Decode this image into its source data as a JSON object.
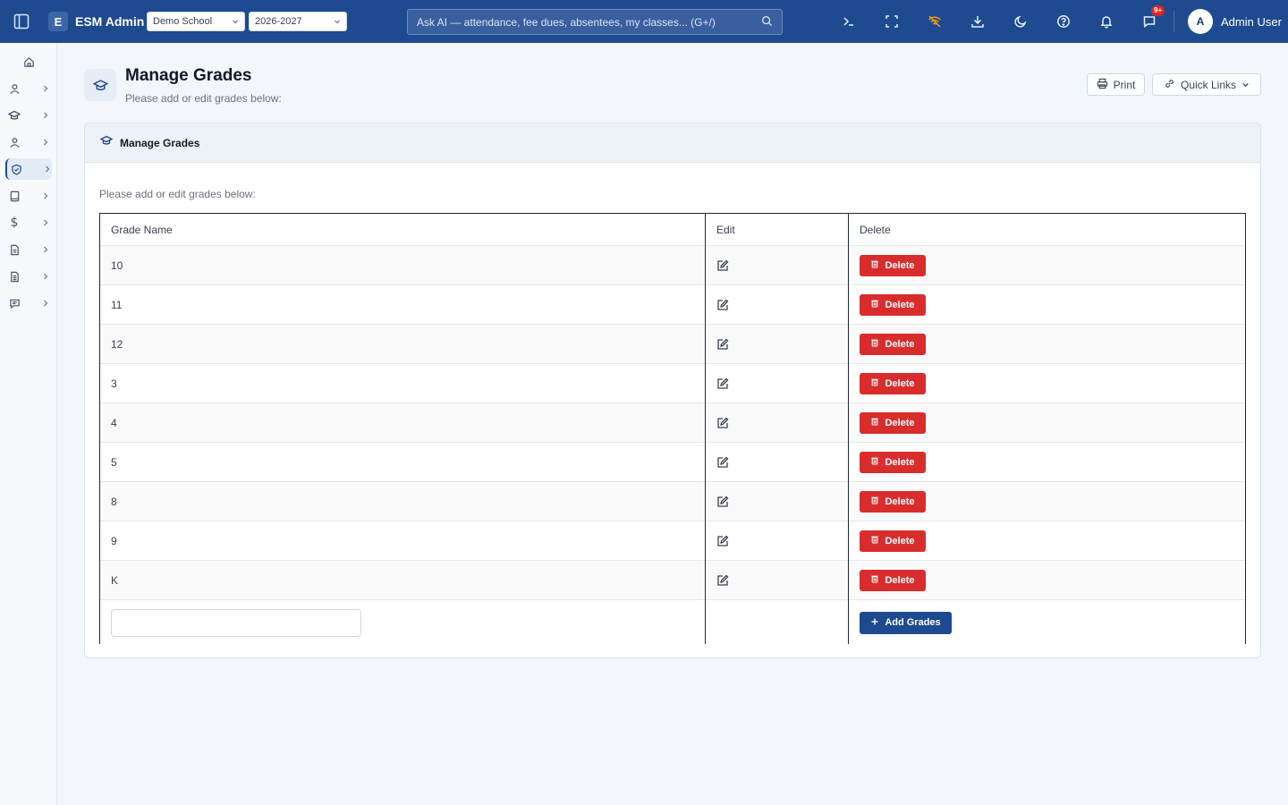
{
  "topbar": {
    "logo_letter": "E",
    "app_title": "ESM Admin",
    "school_select": "Demo School",
    "year_select": "2026-2027",
    "ai_placeholder": "Ask AI — attendance, fee dues, absentees, my classes... (G+/)",
    "notif_badge": "9+",
    "user_initial": "A",
    "user_name": "Admin User"
  },
  "sidebar": {
    "items": [
      {
        "icon": "home-icon"
      },
      {
        "icon": "user-icon"
      },
      {
        "icon": "graduation-cap-icon"
      },
      {
        "icon": "person-icon"
      },
      {
        "icon": "shield-check-icon",
        "active": true
      },
      {
        "icon": "book-icon"
      },
      {
        "icon": "dollar-icon"
      },
      {
        "icon": "document-icon"
      },
      {
        "icon": "report-icon"
      },
      {
        "icon": "message-icon"
      }
    ]
  },
  "page": {
    "title": "Manage Grades",
    "subtitle": "Please add or edit grades below:",
    "print_label": "Print",
    "quick_links_label": "Quick Links"
  },
  "card": {
    "title": "Manage Grades",
    "note": "Please add or edit grades below:",
    "columns": [
      "Grade Name",
      "Edit",
      "Delete"
    ],
    "delete_label": "Delete",
    "add_label": "Add Grades",
    "new_grade_value": "",
    "grades": [
      "10",
      "11",
      "12",
      "3",
      "4",
      "5",
      "8",
      "9",
      "K"
    ]
  },
  "colors": {
    "topbar": "#1e4a8f",
    "delete": "#d92d2d",
    "primary": "#1e4a8f"
  }
}
